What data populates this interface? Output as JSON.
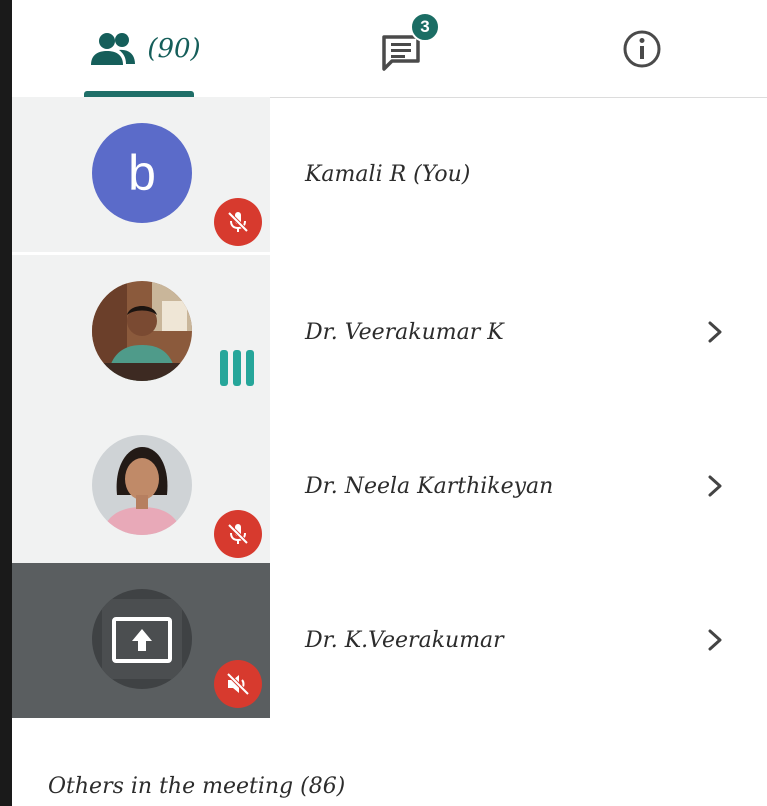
{
  "tabs": {
    "people": {
      "icon": "people-icon",
      "count_label": "(90)"
    },
    "chat": {
      "icon": "chat-icon",
      "badge": "3"
    },
    "info": {
      "icon": "info-icon"
    }
  },
  "participants": [
    {
      "name": "Kamali R (You)",
      "avatar": "letter",
      "avatar_letter": "b",
      "avatar_color": "#5b6bc9",
      "status": "mic-muted",
      "has_chevron": false
    },
    {
      "name": "Dr. Veerakumar K",
      "avatar": "photo",
      "status": "speaking",
      "has_chevron": true
    },
    {
      "name": "Dr. Neela Karthikeyan",
      "avatar": "photo",
      "status": "mic-muted",
      "has_chevron": true
    },
    {
      "name": "Dr. K.Veerakumar",
      "avatar": "photo-presenting",
      "status": "audio-muted",
      "has_chevron": true
    }
  ],
  "others": {
    "label": "Others in the meeting (86)"
  },
  "colors": {
    "accent": "#1f6f68",
    "muted": "#d73a2e",
    "speaking": "#26a69a",
    "avatar_letter_bg": "#5b6bc9",
    "presenting_tile": "#5a5e60"
  }
}
